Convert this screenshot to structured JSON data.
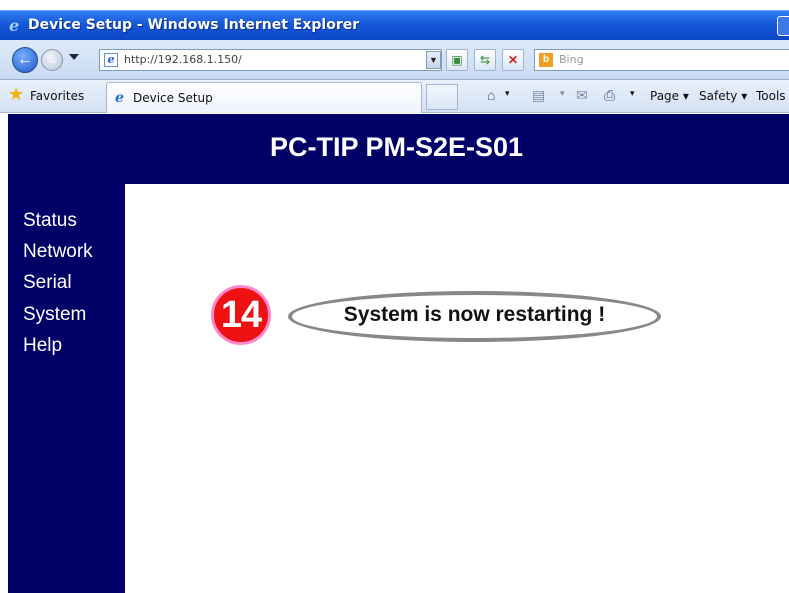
{
  "window": {
    "title": "Device Setup - Windows Internet Explorer"
  },
  "address_bar": {
    "url": "http://192.168.1.150/"
  },
  "search": {
    "placeholder": "Bing"
  },
  "favorites_bar": {
    "favorites_label": "Favorites",
    "tab_label": "Device Setup"
  },
  "command_bar": {
    "page_label": "Page ▾",
    "safety_label": "Safety ▾",
    "tools_label": "Tools ▾"
  },
  "page": {
    "title": "PC-TIP PM-S2E-S01",
    "menu": [
      "Status",
      "Network",
      "Serial",
      "System",
      "Help"
    ],
    "step_number": "14",
    "message": "System is now restarting !"
  },
  "colors": {
    "header_bg": "#000066",
    "badge_red": "#ee1111",
    "oval_gray": "#888888"
  }
}
